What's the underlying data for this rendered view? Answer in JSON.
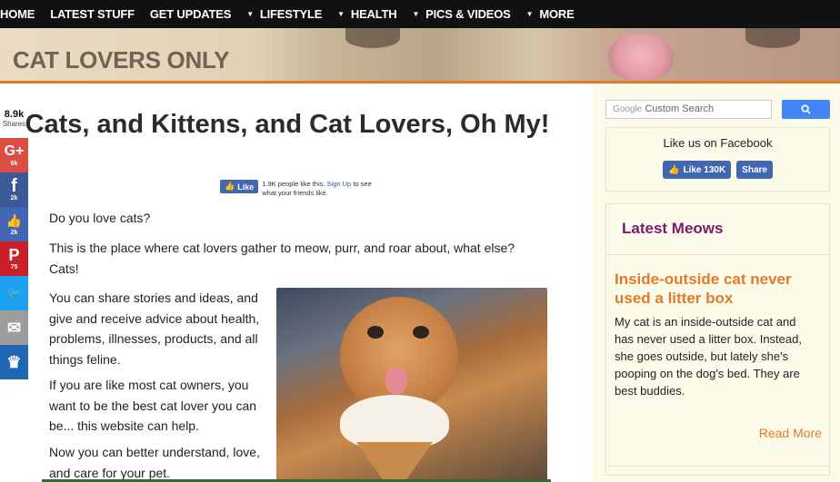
{
  "nav": {
    "items": [
      {
        "label": "HOME",
        "caret": false
      },
      {
        "label": "LATEST STUFF",
        "caret": false
      },
      {
        "label": "GET UPDATES",
        "caret": false
      },
      {
        "label": "LIFESTYLE",
        "caret": true
      },
      {
        "label": "HEALTH",
        "caret": true
      },
      {
        "label": "PICS & VIDEOS",
        "caret": true
      },
      {
        "label": "MORE",
        "caret": true
      }
    ]
  },
  "header": {
    "site_title": "CAT LOVERS ONLY"
  },
  "share": {
    "total": "8.9k",
    "total_label": "Shares",
    "buttons": [
      {
        "name": "google-plus",
        "icon": "G+",
        "count": "6k",
        "color": "#dc4e41"
      },
      {
        "name": "facebook",
        "icon": "f",
        "count": "2k",
        "color": "#3b5998"
      },
      {
        "name": "like",
        "icon": "👍",
        "count": "2k",
        "color": "#4267b2"
      },
      {
        "name": "pinterest",
        "icon": "P",
        "count": "75",
        "color": "#cb2027"
      },
      {
        "name": "twitter",
        "icon": "🐦",
        "count": "",
        "color": "#1da1f2"
      },
      {
        "name": "email",
        "icon": "✉",
        "count": "",
        "color": "#9d9d9d"
      },
      {
        "name": "sumome",
        "icon": "♛",
        "count": "",
        "color": "#1f66b5"
      }
    ]
  },
  "article": {
    "title": "Cats, and Kittens, and Cat Lovers, Oh My!",
    "fb_like": {
      "button": "Like",
      "text_prefix": "1.9K people like this.",
      "signup": "Sign Up",
      "text_suffix": "to see what your friends like."
    },
    "paragraphs": [
      "Do you love cats?",
      "This is the place where cat lovers gather to meow, purr, and roar about, what else? Cats!",
      "You can share stories and ideas, and give and receive advice about health, problems, illnesses, products, and all things feline.",
      "If you are like most cat owners, you want to be the best cat lover you can be... this website can help.",
      "Now you can better understand, love, and care for your pet."
    ]
  },
  "sidebar": {
    "search": {
      "brand": "Google",
      "placeholder": "Custom Search",
      "button_icon": "search-icon"
    },
    "facebook": {
      "title": "Like us on Facebook",
      "like_label": "Like 130K",
      "share_label": "Share"
    },
    "meows": {
      "title": "Latest Meows",
      "post_title": "Inside-outside cat never used a litter box",
      "post_body": "My cat is an inside-outside cat and has never used a litter box. Instead, she goes outside, but lately she's pooping on the dog's bed. They are best buddies.",
      "read_more": "Read More"
    }
  },
  "colors": {
    "accent": "#e17b2a",
    "purple": "#7a1a6e",
    "fb_blue": "#4267b2",
    "google_blue": "#4285f4"
  }
}
